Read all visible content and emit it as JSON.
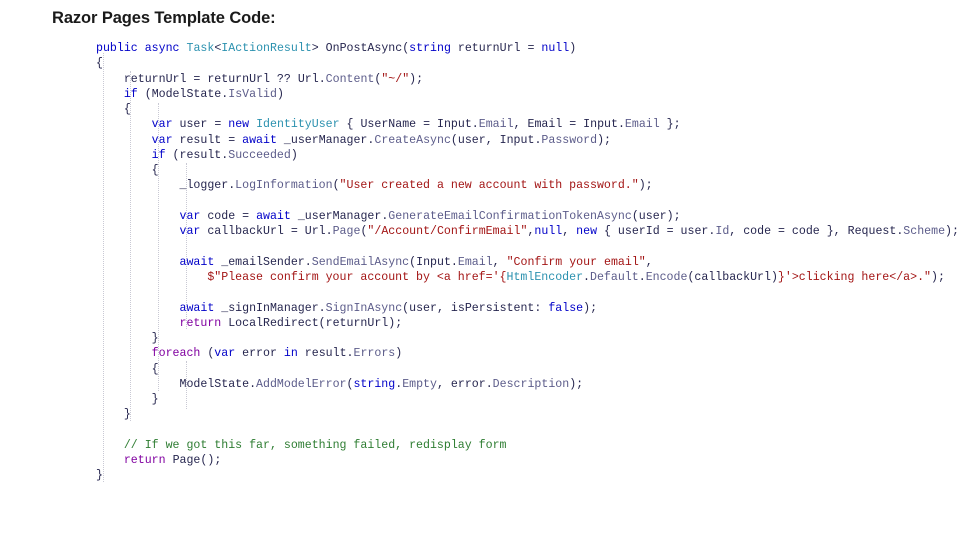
{
  "slide": {
    "title": "Razor Pages Template Code:",
    "background_color": "#ffffff"
  },
  "syntax_colors": {
    "keyword": "#0000c8",
    "type": "#2b91af",
    "string": "#a31515",
    "comment": "#2e7d32",
    "member": "#5c5c8a",
    "identifier": "#26264f",
    "control_keyword": "#8000a0",
    "guide_line": "#c9c9d4"
  },
  "code": {
    "language": "csharp",
    "lines": [
      "public async Task<IActionResult> OnPostAsync(string returnUrl = null)",
      "{",
      "    returnUrl = returnUrl ?? Url.Content(\"~/\");",
      "    if (ModelState.IsValid)",
      "    {",
      "        var user = new IdentityUser { UserName = Input.Email, Email = Input.Email };",
      "        var result = await _userManager.CreateAsync(user, Input.Password);",
      "        if (result.Succeeded)",
      "        {",
      "            _logger.LogInformation(\"User created a new account with password.\");",
      "",
      "            var code = await _userManager.GenerateEmailConfirmationTokenAsync(user);",
      "            var callbackUrl = Url.Page(\"/Account/ConfirmEmail\",null, new { userId = user.Id, code = code }, Request.Scheme);",
      "",
      "            await _emailSender.SendEmailAsync(Input.Email, \"Confirm your email\",",
      "                $\"Please confirm your account by <a href='{HtmlEncoder.Default.Encode(callbackUrl)}'>clicking here</a>.\");",
      "",
      "            await _signInManager.SignInAsync(user, isPersistent: false);",
      "            return LocalRedirect(returnUrl);",
      "        }",
      "        foreach (var error in result.Errors)",
      "        {",
      "            ModelState.AddModelError(string.Empty, error.Description);",
      "        }",
      "    }",
      "",
      "    // If we got this far, something failed, redisplay form",
      "    return Page();",
      "}"
    ]
  }
}
